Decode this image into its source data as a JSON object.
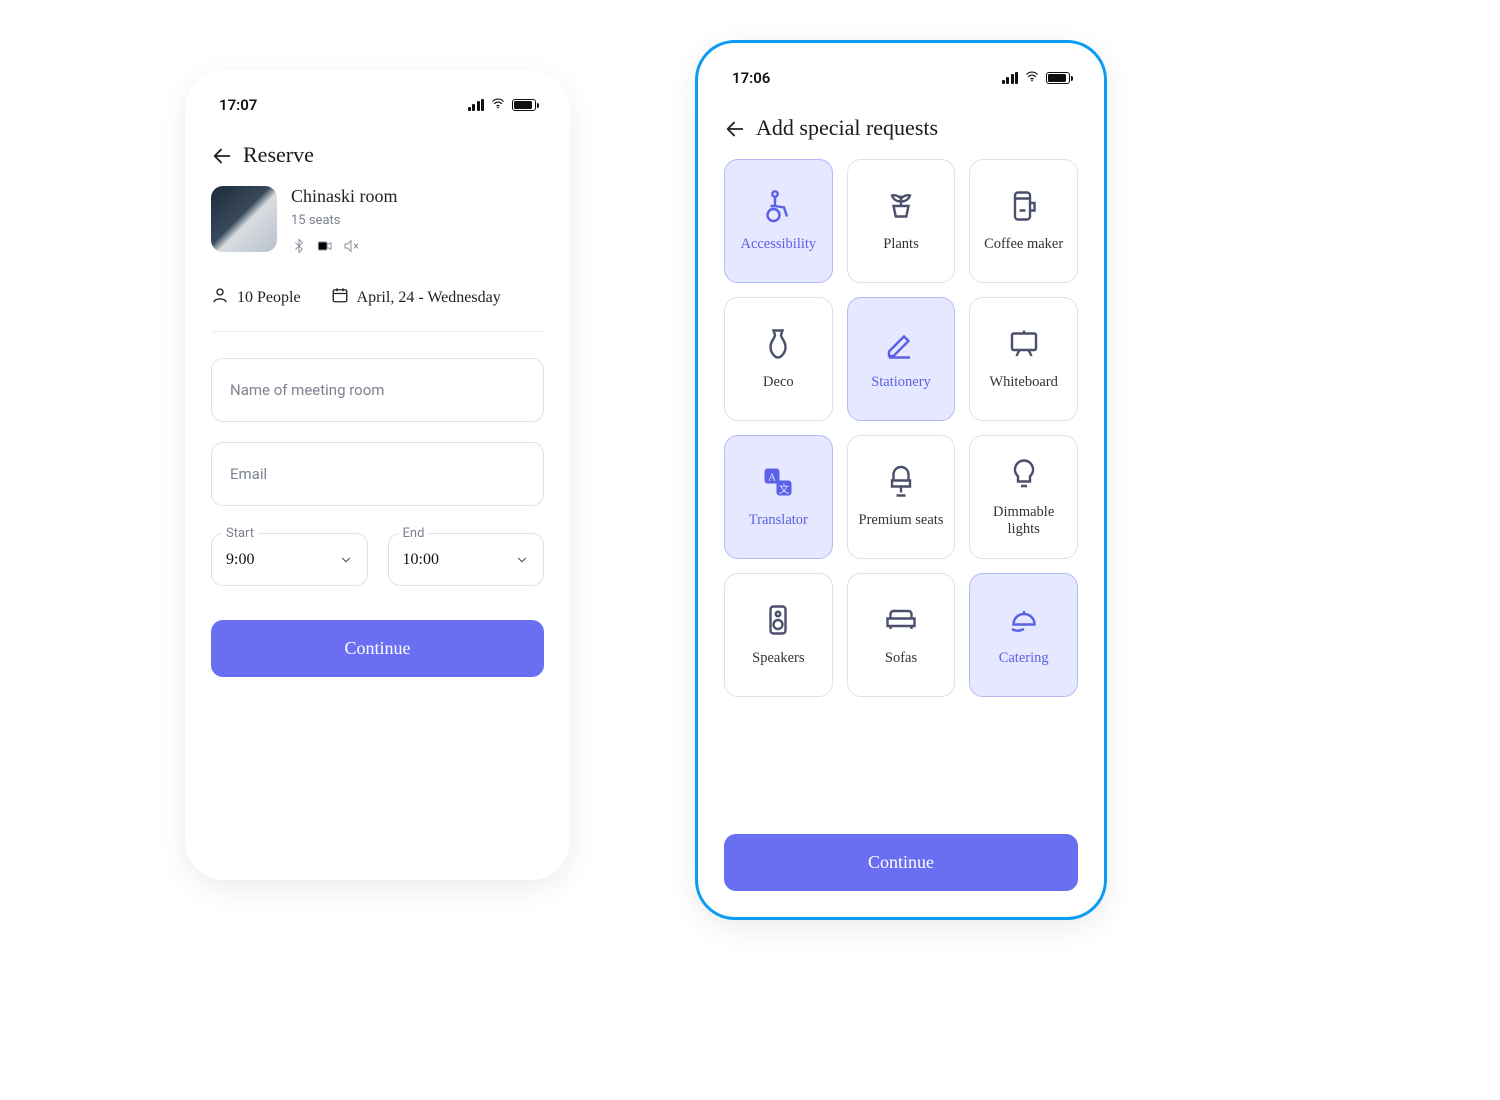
{
  "phone_left": {
    "status_time": "17:07",
    "header": "Reserve",
    "room": {
      "name": "Chinaski room",
      "seats": "15 seats"
    },
    "people": "10 People",
    "date": "April, 24 - Wednesday",
    "input_name_placeholder": "Name of meeting room",
    "input_email_placeholder": "Email",
    "start_label": "Start",
    "start_value": "9:00",
    "end_label": "End",
    "end_value": "10:00",
    "continue": "Continue"
  },
  "phone_right": {
    "status_time": "17:06",
    "header": "Add special requests",
    "cards": {
      "accessibility": "Accessibility",
      "plants": "Plants",
      "coffee": "Coffee maker",
      "deco": "Deco",
      "stationery": "Stationery",
      "whiteboard": "Whiteboard",
      "translator": "Translator",
      "premium_seats": "Premium seats",
      "dimmable": "Dimmable lights",
      "speakers": "Speakers",
      "sofas": "Sofas",
      "catering": "Catering"
    },
    "continue": "Continue"
  },
  "colors": {
    "accent": "#6a6ff2",
    "selection_bg": "#e6e8ff",
    "focus_border": "#0a9bf5"
  }
}
